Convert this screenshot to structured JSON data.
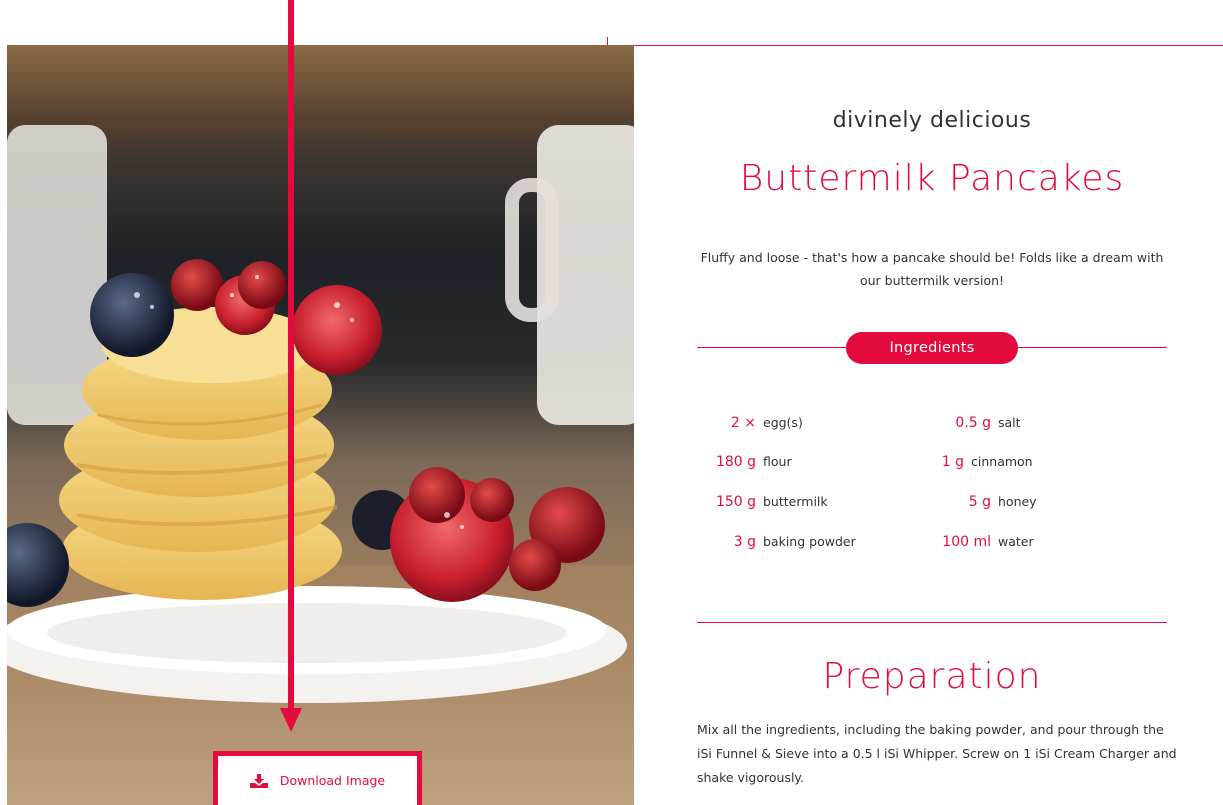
{
  "recipe": {
    "tagline": "divinely delicious",
    "title": "Buttermilk Pancakes",
    "intro": "Fluffy and loose - that's how a pancake should be! Folds like a dream with our buttermilk version!",
    "ingredients_heading": "Ingredients",
    "ingredients": [
      {
        "amount": "2 ×",
        "name": "egg(s)"
      },
      {
        "amount": "180 g",
        "name": "flour"
      },
      {
        "amount": "150 g",
        "name": "buttermilk"
      },
      {
        "amount": "3 g",
        "name": "baking powder"
      },
      {
        "amount": "0.5 g",
        "name": "salt"
      },
      {
        "amount": "1 g",
        "name": "cinnamon"
      },
      {
        "amount": "5 g",
        "name": "honey"
      },
      {
        "amount": "100 ml",
        "name": "water"
      }
    ],
    "preparation_heading": "Preparation",
    "preparation_text": "Mix all the ingredients, including the baking powder, and pour through the iSi Funnel & Sieve into a 0.5 l iSi Whipper. Screw on 1 iSi Cream Charger and shake vigorously."
  },
  "media": {
    "download_label": "Download Image",
    "download_icon": "download-icon"
  },
  "colors": {
    "accent": "#e30b3e",
    "text": "#333333",
    "background": "#ffffff"
  }
}
